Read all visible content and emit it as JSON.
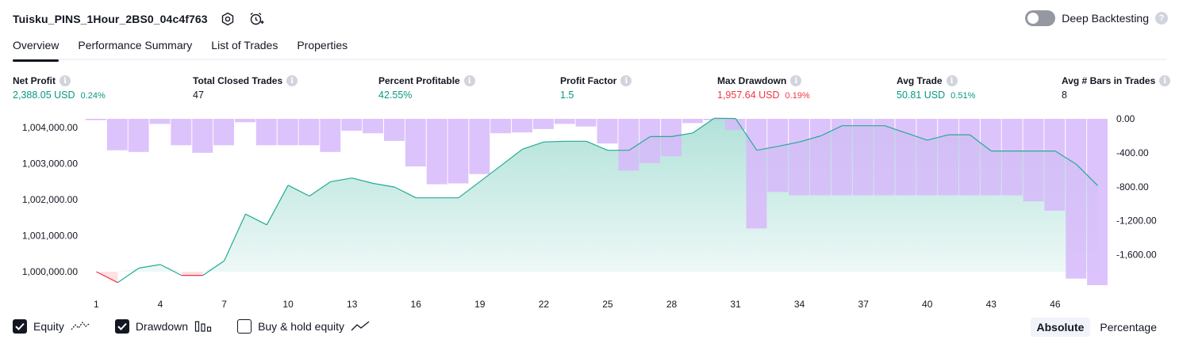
{
  "header": {
    "strategy_name": "Tuisku_PINS_1Hour_2BS0_04c4f763",
    "settings_icon": "hexagon-gear-icon",
    "alarm_icon": "alarm-clock-add-icon"
  },
  "deep_backtesting": {
    "label": "Deep Backtesting",
    "enabled": false,
    "help_icon": "question-icon"
  },
  "tabs": [
    {
      "label": "Overview",
      "active": true
    },
    {
      "label": "Performance Summary",
      "active": false
    },
    {
      "label": "List of Trades",
      "active": false
    },
    {
      "label": "Properties",
      "active": false
    }
  ],
  "metrics": {
    "net_profit": {
      "label": "Net Profit",
      "value": "2,388.05 USD",
      "pct": "0.24%"
    },
    "total_closed_trades": {
      "label": "Total Closed Trades",
      "value": "47"
    },
    "percent_profitable": {
      "label": "Percent Profitable",
      "value": "42.55%"
    },
    "profit_factor": {
      "label": "Profit Factor",
      "value": "1.5"
    },
    "max_drawdown": {
      "label": "Max Drawdown",
      "value": "1,957.64 USD",
      "pct": "0.19%"
    },
    "avg_trade": {
      "label": "Avg Trade",
      "value": "50.81 USD",
      "pct": "0.51%"
    },
    "avg_bars": {
      "label": "Avg # Bars in Trades",
      "value": "8"
    }
  },
  "chart_data": {
    "type": "line",
    "x": [
      1,
      2,
      3,
      4,
      5,
      6,
      7,
      8,
      9,
      10,
      11,
      12,
      13,
      14,
      15,
      16,
      17,
      18,
      19,
      20,
      21,
      22,
      23,
      24,
      25,
      26,
      27,
      28,
      29,
      30,
      31,
      32,
      33,
      34,
      35,
      36,
      37,
      38,
      39,
      40,
      41,
      42,
      43,
      44,
      45,
      46,
      47,
      48
    ],
    "x_ticks": [
      "1",
      "4",
      "7",
      "10",
      "13",
      "16",
      "19",
      "22",
      "25",
      "28",
      "31",
      "34",
      "37",
      "40",
      "43",
      "46"
    ],
    "series": [
      {
        "name": "Equity",
        "axis": "left",
        "values": [
          1000000,
          999700,
          1000100,
          1000200,
          999900,
          999900,
          1000300,
          1001600,
          1001300,
          1002400,
          1002100,
          1002500,
          1002600,
          1002450,
          1002350,
          1002050,
          1002050,
          1002050,
          1002500,
          1002950,
          1003400,
          1003600,
          1003620,
          1003620,
          1003370,
          1003370,
          1003750,
          1003750,
          1003850,
          1004260,
          1004250,
          1003370,
          1003480,
          1003600,
          1003770,
          1004050,
          1004050,
          1004050,
          1003850,
          1003650,
          1003800,
          1003800,
          1003350,
          1003350,
          1003350,
          1003350,
          1002980,
          1002390
        ]
      },
      {
        "name": "Drawdown",
        "axis": "right",
        "values": [
          0,
          -370,
          -390,
          -60,
          -310,
          -400,
          -310,
          -40,
          -310,
          -310,
          -310,
          -390,
          -140,
          -170,
          -260,
          -560,
          -770,
          -760,
          -650,
          -170,
          -160,
          -120,
          -60,
          -90,
          -290,
          -610,
          -520,
          -440,
          -50,
          0,
          -130,
          -1290,
          -860,
          -900,
          -900,
          -900,
          -900,
          -900,
          -900,
          -900,
          -900,
          -900,
          -900,
          -900,
          -970,
          -1080,
          -1880,
          -1957.64
        ]
      }
    ],
    "ylim_left": [
      999500,
      1004260
    ],
    "yticks_left": [
      "1,004,000.00",
      "1,003,000.00",
      "1,002,000.00",
      "1,001,000.00",
      "1,000,000.00"
    ],
    "ylim_right": [
      -1957.64,
      0
    ],
    "yticks_right": [
      "0.00",
      "-400.00",
      "-800.00",
      "-1,200.00",
      "-1,600.00"
    ],
    "colors": {
      "equity_line": "#22ab94",
      "equity_negative": "#f23645",
      "equity_fill": "#22ab94",
      "drawdown_bar": "#d7b8fa",
      "drawdown_overlap": "#a6b1e1"
    }
  },
  "footer": {
    "legend": [
      {
        "label": "Equity",
        "checked": true,
        "icon": "equity-line-icon"
      },
      {
        "label": "Drawdown",
        "checked": true,
        "icon": "drawdown-bars-icon"
      },
      {
        "label": "Buy & hold equity",
        "checked": false,
        "icon": "buy-hold-line-icon"
      }
    ],
    "view_toggle": {
      "absolute_label": "Absolute",
      "percentage_label": "Percentage",
      "active": "Absolute"
    }
  }
}
